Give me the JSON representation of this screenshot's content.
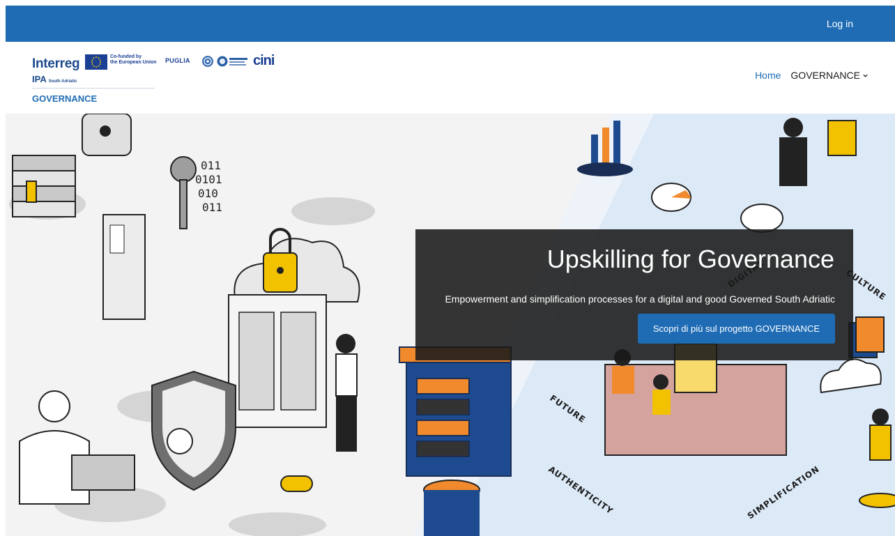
{
  "topbar": {
    "login_label": "Log in"
  },
  "brand": {
    "interreg": "Interreg",
    "cofunded_line1": "Co-funded by",
    "cofunded_line2": "the European Union",
    "puglia": "PUGLIA",
    "cini": "cini",
    "ipa": "IPA",
    "ipa_region": "South Adriatic",
    "project_name": "GOVERNANCE"
  },
  "nav": {
    "items": [
      {
        "label": "Home"
      },
      {
        "label": "GOVERNANCE"
      }
    ]
  },
  "hero": {
    "title": "Upskilling for Governance",
    "subtitle": "Empowerment and simplification processes for a digital and good Governed South Adriatic",
    "cta_label": "Scopri di più sul progetto GOVERNANCE",
    "illustration_words": [
      "DIGITAL",
      "CULTURE",
      "FUTURE",
      "AUTHENTICITY",
      "SIMPLIFICATION"
    ]
  },
  "colors": {
    "primary": "#1f6cb5",
    "panel": "#191919",
    "accent_yellow": "#f2c200",
    "accent_orange": "#f08a2c",
    "illustration_blue": "#dce9f7"
  }
}
